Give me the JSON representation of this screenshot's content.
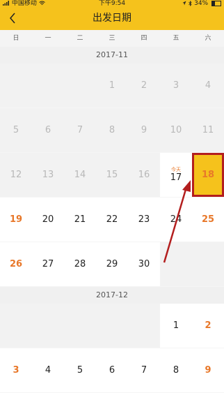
{
  "status_bar": {
    "carrier": "中国移动",
    "time": "下午9:54",
    "battery": "34%"
  },
  "nav": {
    "title": "出发日期"
  },
  "weekdays": [
    "日",
    "一",
    "二",
    "三",
    "四",
    "五",
    "六"
  ],
  "months": [
    {
      "label": "2017-11",
      "weeks": [
        [
          null,
          null,
          null,
          "1",
          "2",
          "3",
          "4"
        ],
        [
          "5",
          "6",
          "7",
          "8",
          "9",
          "10",
          "11"
        ],
        [
          "12",
          "13",
          "14",
          "15",
          "16",
          "17",
          "18"
        ],
        [
          "19",
          "20",
          "21",
          "22",
          "23",
          "24",
          "25"
        ],
        [
          "26",
          "27",
          "28",
          "29",
          "30",
          null,
          null
        ]
      ]
    },
    {
      "label": "2017-12",
      "weeks": [
        [
          null,
          null,
          null,
          null,
          null,
          "1",
          "2"
        ],
        [
          "3",
          "4",
          "5",
          "6",
          "7",
          "8",
          "9"
        ]
      ]
    }
  ],
  "today": {
    "label": "今天",
    "date": "17"
  },
  "selected_date": "18",
  "colors": {
    "header_yellow": "#f5c21c",
    "weekend_orange": "#e8782a",
    "highlight_red": "#b31e1e"
  }
}
